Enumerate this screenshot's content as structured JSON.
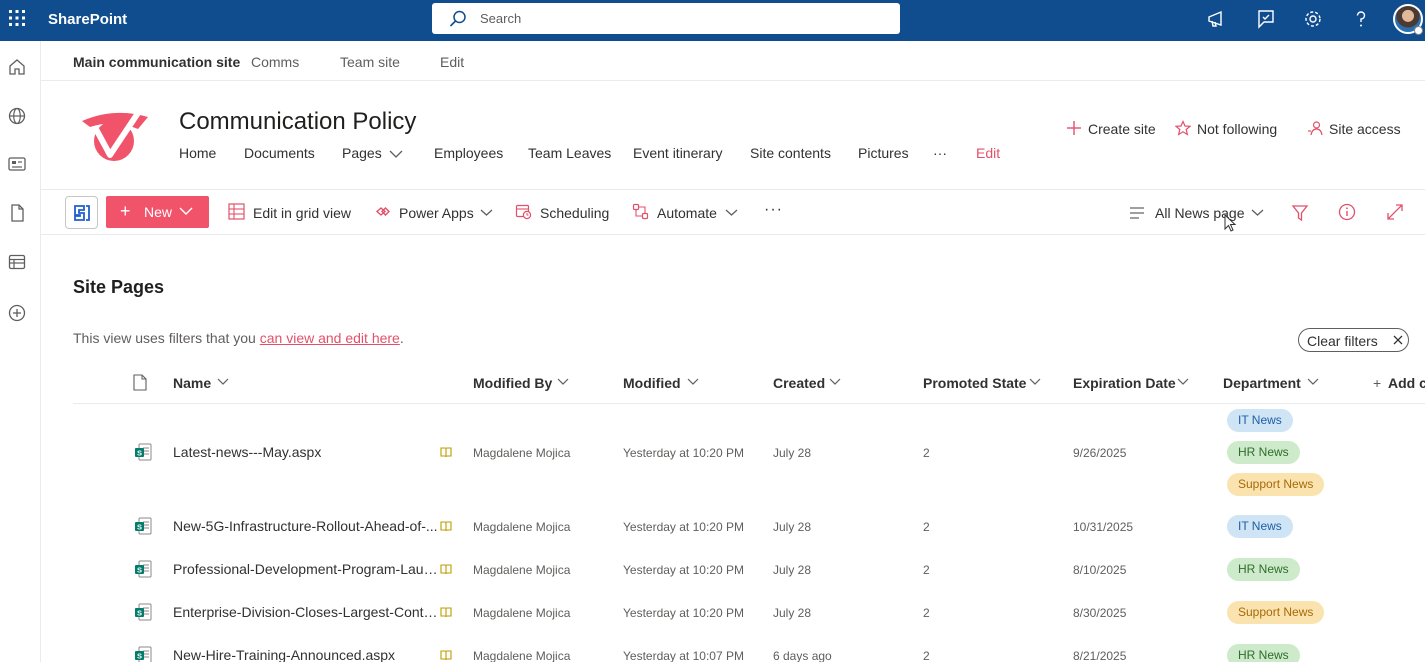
{
  "suite": {
    "app_name": "SharePoint",
    "search_placeholder": "Search",
    "icons": [
      "waffle-icon",
      "megaphone-icon",
      "feedback-icon",
      "gear-icon",
      "help-icon"
    ]
  },
  "hub_nav": {
    "home": "Main communication site",
    "items": [
      "Comms",
      "Team site",
      "Edit"
    ]
  },
  "site": {
    "title": "Communication Policy",
    "nav": [
      "Home",
      "Documents",
      "Pages",
      "Employees",
      "Team Leaves",
      "Event itinerary",
      "Site contents",
      "Pictures",
      "···",
      "Edit"
    ],
    "actions": {
      "create_site": "Create site",
      "follow": "Not following",
      "access": "Site access"
    },
    "accent_color": "#e3506a"
  },
  "command_bar": {
    "new_label": "New",
    "edit_grid": "Edit in grid view",
    "power_apps": "Power Apps",
    "scheduling": "Scheduling",
    "automate": "Automate",
    "more": "···",
    "view_name": "All News page"
  },
  "main": {
    "title": "Site Pages",
    "filter_note": "This view uses filters that you ",
    "filter_link": "can view and edit here",
    "filter_end": ".",
    "clear_filters": "Clear filters"
  },
  "table": {
    "columns": {
      "name": "Name",
      "modified_by": "Modified By",
      "modified": "Modified",
      "created": "Created",
      "promoted": "Promoted State",
      "expiration": "Expiration Date",
      "department": "Department",
      "add": "Add c"
    },
    "rows": [
      {
        "name": "Latest-news---May.aspx",
        "modified_by": "Magdalene Mojica",
        "modified": "Yesterday at 10:20 PM",
        "created": "July 28",
        "promoted": "2",
        "expiration": "9/26/2025",
        "departments": [
          "IT News",
          "HR News",
          "Support News"
        ]
      },
      {
        "name": "New-5G-Infrastructure-Rollout-Ahead-of-...",
        "modified_by": "Magdalene Mojica",
        "modified": "Yesterday at 10:20 PM",
        "created": "July 28",
        "promoted": "2",
        "expiration": "10/31/2025",
        "departments": [
          "IT News"
        ]
      },
      {
        "name": "Professional-Development-Program-Laun...",
        "modified_by": "Magdalene Mojica",
        "modified": "Yesterday at 10:20 PM",
        "created": "July 28",
        "promoted": "2",
        "expiration": "8/10/2025",
        "departments": [
          "HR News"
        ]
      },
      {
        "name": "Enterprise-Division-Closes-Largest-Contra...",
        "modified_by": "Magdalene Mojica",
        "modified": "Yesterday at 10:20 PM",
        "created": "July 28",
        "promoted": "2",
        "expiration": "8/30/2025",
        "departments": [
          "Support News"
        ]
      },
      {
        "name": "New-Hire-Training-Announced.aspx",
        "modified_by": "Magdalene Mojica",
        "modified": "Yesterday at 10:07 PM",
        "created": "6 days ago",
        "promoted": "2",
        "expiration": "8/21/2025",
        "departments": [
          "HR News"
        ]
      }
    ]
  }
}
